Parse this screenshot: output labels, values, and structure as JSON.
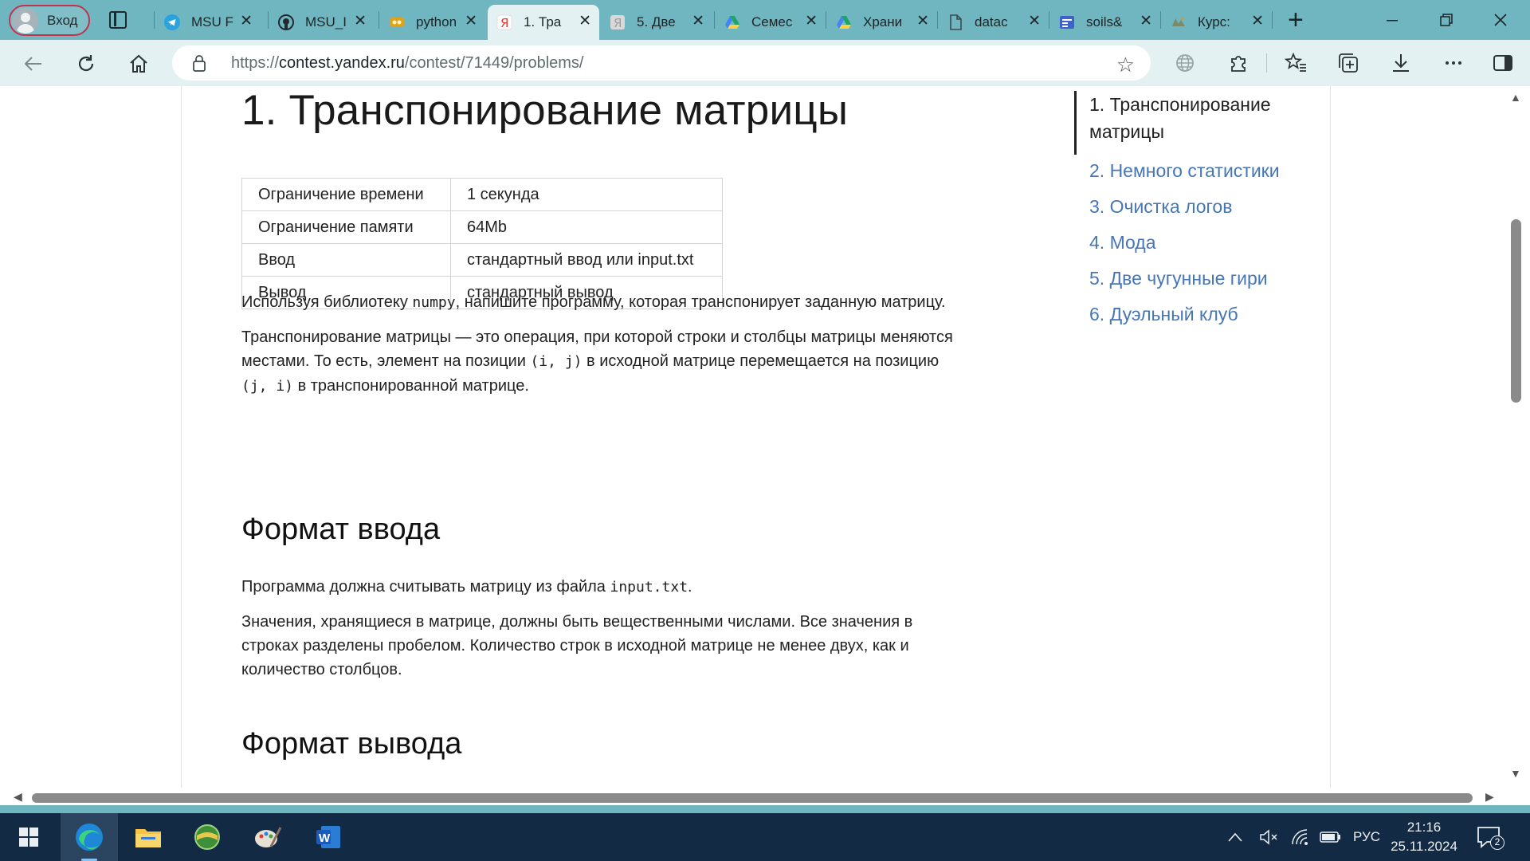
{
  "browser": {
    "profile_label": "Вход",
    "tabs": [
      {
        "title": "MSU F",
        "favicon": "telegram-icon",
        "color": "#2aa3de",
        "active": false
      },
      {
        "title": "MSU_I",
        "favicon": "github-icon",
        "color": "#24292f",
        "active": false
      },
      {
        "title": "python",
        "favicon": "python-course-icon",
        "color": "#e0a21a",
        "active": false
      },
      {
        "title": "1. Тра",
        "favicon": "yandex-icon",
        "color": "#e53935",
        "active": true
      },
      {
        "title": "5. Две",
        "favicon": "yandex-icon",
        "color": "#9e9e9e",
        "active": false
      },
      {
        "title": "Семес",
        "favicon": "google-drive-icon",
        "color": "#1fa463",
        "active": false
      },
      {
        "title": "Храни",
        "favicon": "google-drive-icon",
        "color": "#1fa463",
        "active": false
      },
      {
        "title": "datac",
        "favicon": "document-icon",
        "color": "#5b6e72",
        "active": false
      },
      {
        "title": "soils&",
        "favicon": "form-icon",
        "color": "#3f62c8",
        "active": false
      },
      {
        "title": "Курс:",
        "favicon": "course-icon",
        "color": "#7b8b6a",
        "active": false
      }
    ],
    "url_prefix": "https://",
    "url_host": "contest.yandex.ru",
    "url_path": "/contest/71449/problems/"
  },
  "problem": {
    "title": "1. Транспонирование матрицы",
    "limits": [
      {
        "label": "Ограничение времени",
        "value": "1 секунда"
      },
      {
        "label": "Ограничение памяти",
        "value": "64Mb"
      },
      {
        "label": "Ввод",
        "value": "стандартный ввод или input.txt"
      },
      {
        "label": "Вывод",
        "value": "стандартный вывод"
      }
    ],
    "intro_1": "Используя библиотеку ",
    "intro_code": "numpy",
    "intro_2": ", напишите программу, которая транспонирует заданную матрицу.",
    "desc_line1": "Транспонирование матрицы — это операция, при которой строки и столбцы матрицы меняются",
    "desc_line2a": "местами. То есть, элемент на позиции ",
    "desc_code1": "(i, j)",
    "desc_line2b": " в исходной матрице перемещается на позицию",
    "desc_code2": "(j, i)",
    "desc_line3": " в транспонированной матрице.",
    "input_heading": "Формат ввода",
    "input_p1a": "Программа должна считывать матрицу из файла ",
    "input_p1_code": "input.txt",
    "input_p1b": ".",
    "input_p2_line1": "Значения, хранящиеся в матрице, должны быть вещественными числами. Все значения в",
    "input_p2_line2": "строках разделены пробелом. Количество строк в исходной матрице не менее двух, как и",
    "input_p2_line3": "количество столбцов.",
    "output_heading": "Формат вывода"
  },
  "toc": {
    "items": [
      "1. Транспонирование матрицы",
      "2. Немного статистики",
      "3. Очистка логов",
      "4. Мода",
      "5. Две чугунные гири",
      "6. Дуэльный клуб"
    ]
  },
  "taskbar": {
    "apps": [
      "windows-start-icon",
      "edge-icon",
      "file-explorer-icon",
      "maps-app-icon",
      "paint-icon",
      "word-icon"
    ],
    "language": "РУС",
    "time": "21:16",
    "date": "25.11.2024",
    "notification_count": "2"
  },
  "colors": {
    "tabbar": "#6fb6c1",
    "toolbar": "#e3f1f3",
    "link": "#4676b6",
    "taskbar": "#132a44"
  }
}
